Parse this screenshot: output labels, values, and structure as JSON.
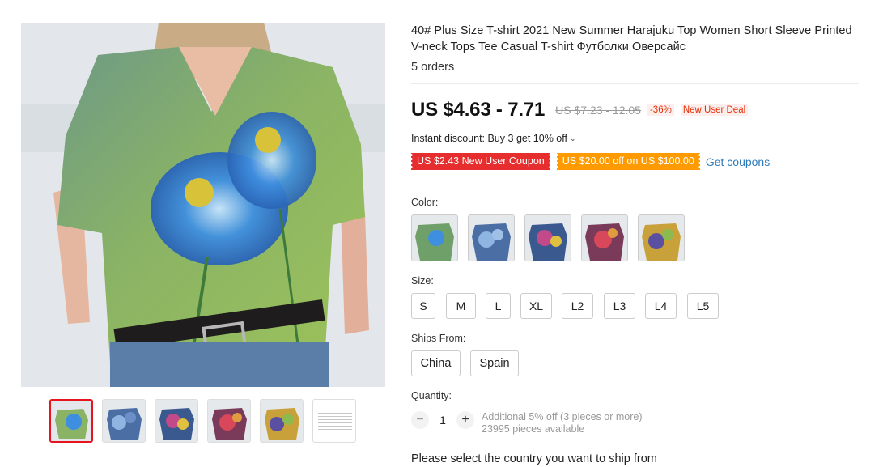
{
  "product": {
    "title": "40# Plus Size T-shirt 2021 New Summer Harajuku Top Women Short Sleeve Printed V-neck Tops Tee Casual T-shirt Футболки Оверсайс",
    "orders": "5 orders",
    "price": "US $4.63 - 7.71",
    "original_price": "US $7.23 - 12.05",
    "discount": "-36%",
    "deal_badge": "New User Deal",
    "instant_discount": "Instant discount: Buy 3 get 10% off",
    "coupons": [
      "US $2.43 New User Coupon",
      "US $20.00 off on US $100.00"
    ],
    "get_coupons": "Get coupons"
  },
  "options": {
    "color_label": "Color:",
    "size_label": "Size:",
    "sizes": [
      "S",
      "M",
      "L",
      "XL",
      "L2",
      "L3",
      "L4",
      "L5"
    ],
    "ships_label": "Ships From:",
    "ships": [
      "China",
      "Spain"
    ]
  },
  "quantity": {
    "label": "Quantity:",
    "value": "1",
    "minus": "−",
    "plus": "+",
    "note_line1": "Additional 5% off (3 pieces or more)",
    "note_line2": "23995 pieces available"
  },
  "ship_message": "Please select the country you want to ship from",
  "colors": {
    "price": "#111111",
    "discount_red": "#e62e04",
    "coupon_red": "#e62e2e",
    "coupon_orange": "#ff9b00",
    "link_blue": "#2e7bb8",
    "active_thumb_border": "#e6141e"
  }
}
